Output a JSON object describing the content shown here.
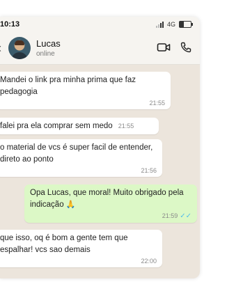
{
  "status_bar": {
    "time": "10:13",
    "network": "4G"
  },
  "contact": {
    "name": "Lucas",
    "status": "online"
  },
  "icons": {
    "back": "back-chevron-icon",
    "video": "video-camera-icon",
    "call": "phone-icon"
  },
  "messages": [
    {
      "dir": "in",
      "text": "Mandei o link pra minha prima que faz pedagogia",
      "time": "21:55"
    },
    {
      "dir": "in",
      "text": "falei pra ela comprar sem medo",
      "time": "21:55"
    },
    {
      "dir": "in",
      "text": "o material de vcs é super facil de entender, direto ao ponto",
      "time": "21:56"
    },
    {
      "dir": "out",
      "text": "Opa Lucas, que moral! Muito obrigado pela indicação",
      "emoji": "🙏",
      "time": "21:59"
    },
    {
      "dir": "in",
      "text": "que isso, oq é bom a gente tem que espalhar! vcs sao demais",
      "time": "22:00"
    }
  ]
}
